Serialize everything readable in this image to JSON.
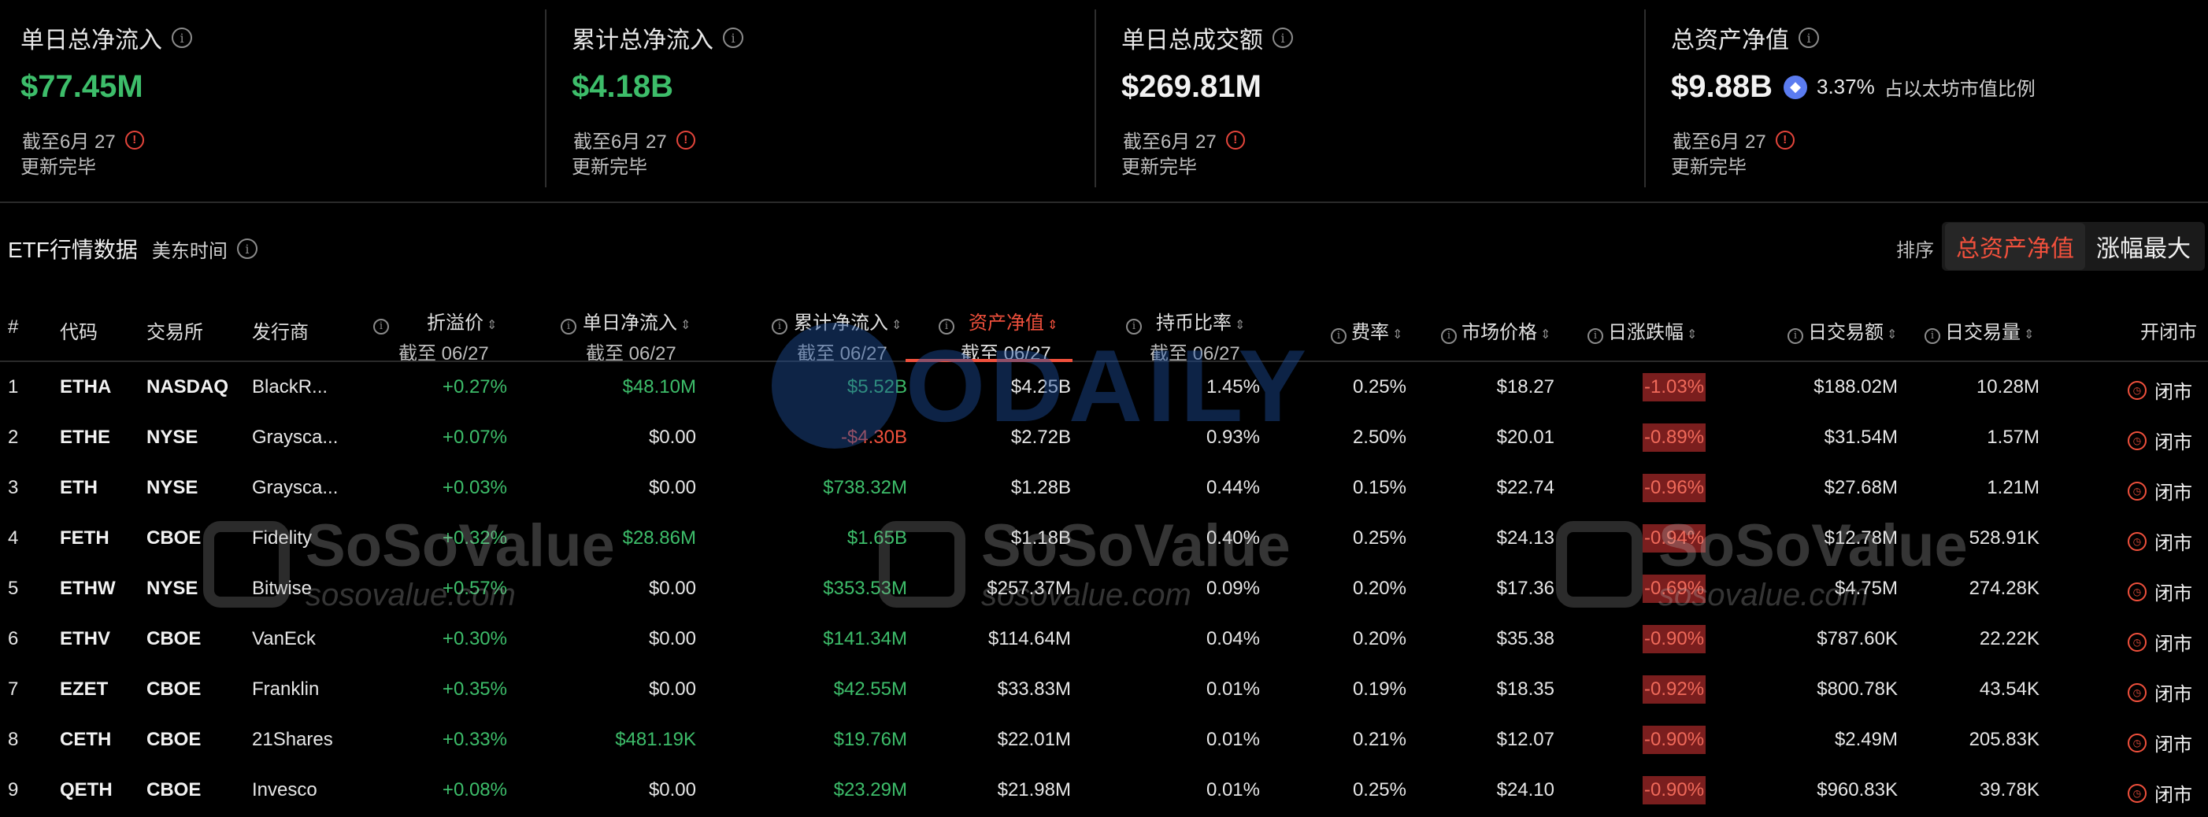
{
  "summary": {
    "daily_net_inflow": {
      "title": "单日总净流入",
      "value": "$77.45M",
      "asof": "截至6月 27",
      "status": "更新完毕"
    },
    "cumulative_net_inflow": {
      "title": "累计总净流入",
      "value": "$4.18B",
      "asof": "截至6月 27",
      "status": "更新完毕"
    },
    "daily_volume": {
      "title": "单日总成交额",
      "value": "$269.81M",
      "asof": "截至6月 27",
      "status": "更新完毕"
    },
    "total_nav": {
      "title": "总资产净值",
      "value": "$9.88B",
      "share_pct": "3.37%",
      "share_label": "占以太坊市值比例",
      "asof": "截至6月 27",
      "status": "更新完毕"
    }
  },
  "section": {
    "title": "ETF行情数据",
    "timezone": "美东时间"
  },
  "sort": {
    "label": "排序",
    "options": [
      "总资产净值",
      "涨幅最大"
    ],
    "active": "总资产净值"
  },
  "table": {
    "headers": {
      "index": "#",
      "code": "代码",
      "exchange": "交易所",
      "issuer": "发行商",
      "premium": "折溢价",
      "daily_inflow": "单日净流入",
      "cum_inflow": "累计净流入",
      "nav": "资产净值",
      "hold_ratio": "持币比率",
      "fee": "费率",
      "price": "市场价格",
      "change": "日涨跌幅",
      "volume_amt": "日交易额",
      "volume_qty": "日交易量",
      "status": "开闭市"
    },
    "asof_sub": "截至 06/27",
    "rows": [
      {
        "idx": "1",
        "code": "ETHA",
        "exchange": "NASDAQ",
        "issuer": "BlackR...",
        "premium": "+0.27%",
        "daily_inflow": "$48.10M",
        "cum_inflow": "$5.52B",
        "nav": "$4.25B",
        "hold_ratio": "1.45%",
        "fee": "0.25%",
        "price": "$18.27",
        "change": "-1.03%",
        "volume_amt": "$188.02M",
        "volume_qty": "10.28M",
        "status": "闭市"
      },
      {
        "idx": "2",
        "code": "ETHE",
        "exchange": "NYSE",
        "issuer": "Graysca...",
        "premium": "+0.07%",
        "daily_inflow": "$0.00",
        "cum_inflow": "-$4.30B",
        "nav": "$2.72B",
        "hold_ratio": "0.93%",
        "fee": "2.50%",
        "price": "$20.01",
        "change": "-0.89%",
        "volume_amt": "$31.54M",
        "volume_qty": "1.57M",
        "status": "闭市"
      },
      {
        "idx": "3",
        "code": "ETH",
        "exchange": "NYSE",
        "issuer": "Graysca...",
        "premium": "+0.03%",
        "daily_inflow": "$0.00",
        "cum_inflow": "$738.32M",
        "nav": "$1.28B",
        "hold_ratio": "0.44%",
        "fee": "0.15%",
        "price": "$22.74",
        "change": "-0.96%",
        "volume_amt": "$27.68M",
        "volume_qty": "1.21M",
        "status": "闭市"
      },
      {
        "idx": "4",
        "code": "FETH",
        "exchange": "CBOE",
        "issuer": "Fidelity",
        "premium": "+0.32%",
        "daily_inflow": "$28.86M",
        "cum_inflow": "$1.65B",
        "nav": "$1.18B",
        "hold_ratio": "0.40%",
        "fee": "0.25%",
        "price": "$24.13",
        "change": "-0.94%",
        "volume_amt": "$12.78M",
        "volume_qty": "528.91K",
        "status": "闭市"
      },
      {
        "idx": "5",
        "code": "ETHW",
        "exchange": "NYSE",
        "issuer": "Bitwise",
        "premium": "+0.57%",
        "daily_inflow": "$0.00",
        "cum_inflow": "$353.53M",
        "nav": "$257.37M",
        "hold_ratio": "0.09%",
        "fee": "0.20%",
        "price": "$17.36",
        "change": "-0.69%",
        "volume_amt": "$4.75M",
        "volume_qty": "274.28K",
        "status": "闭市"
      },
      {
        "idx": "6",
        "code": "ETHV",
        "exchange": "CBOE",
        "issuer": "VanEck",
        "premium": "+0.30%",
        "daily_inflow": "$0.00",
        "cum_inflow": "$141.34M",
        "nav": "$114.64M",
        "hold_ratio": "0.04%",
        "fee": "0.20%",
        "price": "$35.38",
        "change": "-0.90%",
        "volume_amt": "$787.60K",
        "volume_qty": "22.22K",
        "status": "闭市"
      },
      {
        "idx": "7",
        "code": "EZET",
        "exchange": "CBOE",
        "issuer": "Franklin",
        "premium": "+0.35%",
        "daily_inflow": "$0.00",
        "cum_inflow": "$42.55M",
        "nav": "$33.83M",
        "hold_ratio": "0.01%",
        "fee": "0.19%",
        "price": "$18.35",
        "change": "-0.92%",
        "volume_amt": "$800.78K",
        "volume_qty": "43.54K",
        "status": "闭市"
      },
      {
        "idx": "8",
        "code": "CETH",
        "exchange": "CBOE",
        "issuer": "21Shares",
        "premium": "+0.33%",
        "daily_inflow": "$481.19K",
        "cum_inflow": "$19.76M",
        "nav": "$22.01M",
        "hold_ratio": "0.01%",
        "fee": "0.21%",
        "price": "$12.07",
        "change": "-0.90%",
        "volume_amt": "$2.49M",
        "volume_qty": "205.83K",
        "status": "闭市"
      },
      {
        "idx": "9",
        "code": "QETH",
        "exchange": "CBOE",
        "issuer": "Invesco",
        "premium": "+0.08%",
        "daily_inflow": "$0.00",
        "cum_inflow": "$23.29M",
        "nav": "$21.98M",
        "hold_ratio": "0.01%",
        "fee": "0.25%",
        "price": "$24.10",
        "change": "-0.90%",
        "volume_amt": "$960.83K",
        "volume_qty": "39.78K",
        "status": "闭市"
      }
    ]
  },
  "watermarks": {
    "odaily": "ODAILY",
    "soso_brand": "SoSoValue",
    "soso_url": "sosovalue.com"
  },
  "colors": {
    "positive": "#3dbd6a",
    "negative": "#f0503c",
    "negative_bg": "#7a1e1e",
    "background": "#000000"
  }
}
